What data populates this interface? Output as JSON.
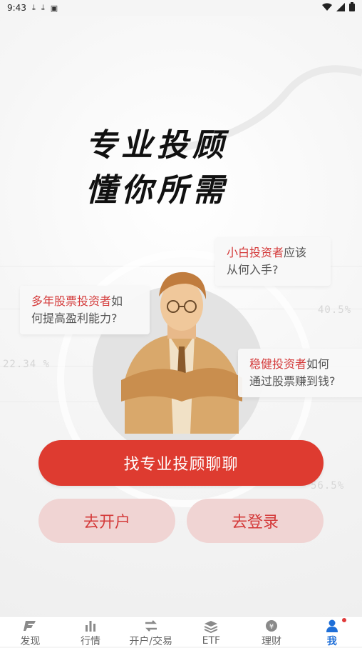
{
  "status_bar": {
    "time": "9:43",
    "icons_left": [
      "download-icon",
      "download-icon",
      "app-icon"
    ],
    "icons_right": [
      "wifi-icon",
      "signal-icon",
      "battery-icon"
    ]
  },
  "hero": {
    "headline_line1": "专业投顾",
    "headline_line2": "懂你所需",
    "bg_percentages": [
      "40.5%",
      "22.34 %",
      "56.5%"
    ]
  },
  "bubbles": [
    {
      "highlight": "小白投资者",
      "rest_line1": "应该",
      "line2": "从何入手?"
    },
    {
      "highlight": "多年股票投资者",
      "rest_line1": "如",
      "line2": "何提高盈利能力?"
    },
    {
      "highlight": "稳健投资者",
      "rest_line1": "如何",
      "line2": "通过股票赚到钱?"
    }
  ],
  "buttons": {
    "primary": "找专业投顾聊聊",
    "open_account": "去开户",
    "login": "去登录"
  },
  "tabs": [
    {
      "label": "发现",
      "icon": "discover-icon"
    },
    {
      "label": "行情",
      "icon": "chart-bar-icon"
    },
    {
      "label": "开户/交易",
      "icon": "swap-icon"
    },
    {
      "label": "ETF",
      "icon": "layers-icon"
    },
    {
      "label": "理财",
      "icon": "yuan-coin-icon"
    },
    {
      "label": "我",
      "icon": "person-icon"
    }
  ],
  "colors": {
    "primary_red": "#de3b30",
    "soft_red_bg": "#f0d4d3",
    "tab_active_blue": "#1f6fd8"
  }
}
